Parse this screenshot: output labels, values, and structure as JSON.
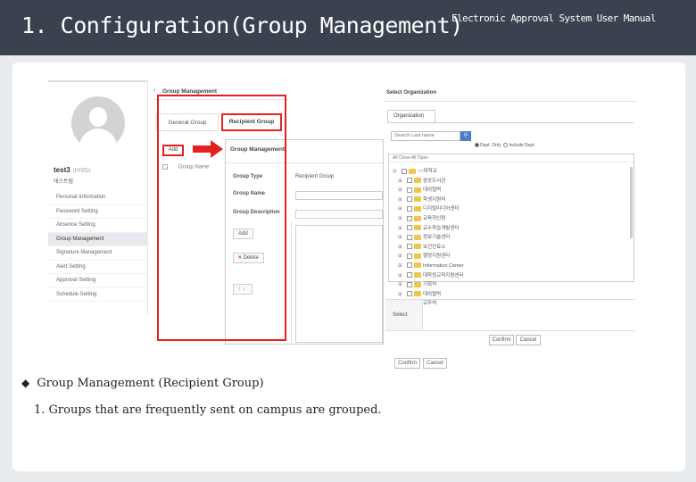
{
  "header": {
    "title": "1. Configuration(Group Management)",
    "manual": "Electronic Approval System User Manual"
  },
  "profile": {
    "name": "test3",
    "sub": "(PFPD)",
    "dept": "데스트팀",
    "menu": [
      "Personal Information",
      "Password Setting",
      "Absence Setting",
      "Group Management",
      "Signature Management",
      "Alert Setting",
      "Approval Setting",
      "Schedule Setting"
    ],
    "active_index": 3
  },
  "group_mgmt": {
    "title": "Group Management",
    "tab_general": "General Group",
    "tab_recipient": "Recipient Group"
  },
  "list": {
    "add_label": "Add",
    "col_header": "Group Name"
  },
  "detail": {
    "title": "Group Management",
    "label_type": "Group Type",
    "value_type": "Recipient Group",
    "label_name": "Group Name",
    "label_desc": "Group Description",
    "add": "Add",
    "delete": "Delete",
    "updown": "↑↓"
  },
  "org": {
    "title": "Select Organization",
    "tab": "Organization",
    "search_placeholder": "Search Last name",
    "radio_dept_only": "Dept. Only",
    "radio_include_dept": "Include Dept.",
    "tree_bar": "All Close    All Open",
    "tree_rows": [
      "○○대학교",
      "중앙도서관",
      "대외협력",
      "학생지원처",
      "디지털미디어센터",
      "교육혁신원",
      "교수학습개발센터",
      "정보기술센터",
      "보건진료소",
      "행정지원센터",
      "Information Center",
      "대학원교학지원센터",
      "기획처",
      "대외협력",
      "교무처"
    ],
    "select_label": "Select",
    "confirm": "Confirm",
    "cancel": "Cancel"
  },
  "bottom_buttons": {
    "confirm": "Confirm",
    "cancel": "Cancel"
  },
  "bullets": {
    "b1": "Group Management (Recipient Group)",
    "b2": "1. Groups that are frequently sent on campus are grouped."
  },
  "colors": {
    "header_bg": "#3a4250",
    "highlight_red": "#e52020",
    "search_blue": "#4a7fc6",
    "folder": "#f0c649"
  }
}
